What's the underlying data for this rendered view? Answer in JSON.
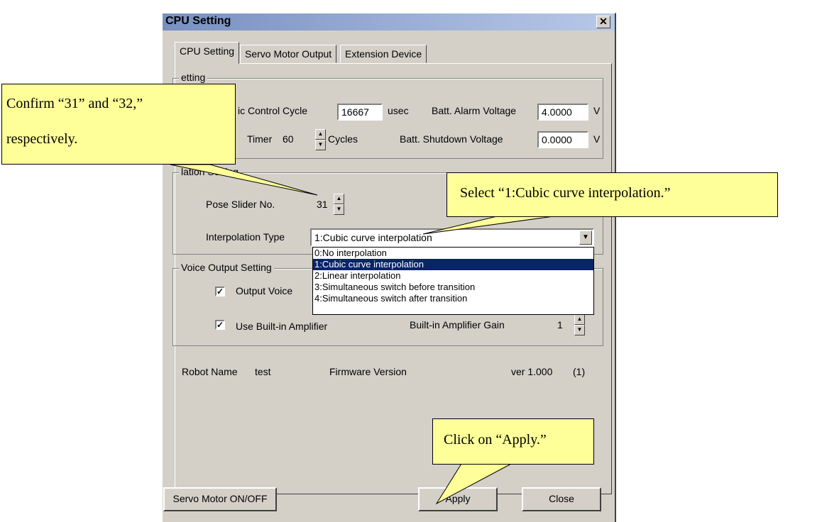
{
  "window": {
    "title": "CPU Setting",
    "close_glyph": "✕"
  },
  "tabs": [
    "CPU Setting",
    "Servo Motor Output",
    "Extension Device"
  ],
  "cpu_group": {
    "legend": "etting",
    "control_cycle_label": "ic Control Cycle",
    "control_cycle_value": "16667",
    "control_cycle_unit": "usec",
    "alarm_label": "Batt. Alarm Voltage",
    "alarm_value": "4.0000",
    "alarm_unit": "V",
    "timer_label": "Timer",
    "timer_value": "60",
    "timer_unit": "Cycles",
    "shutdown_label": "Batt. Shutdown Voltage",
    "shutdown_value": "0.0000",
    "shutdown_unit": "V"
  },
  "interp_group": {
    "legend": "lation Setting",
    "pose_label": "Pose Slider No.",
    "pose_value": "31",
    "type_label": "Interpolation Type",
    "type_value": "1:Cubic curve interpolation",
    "options": [
      "0:No interpolation",
      "1:Cubic curve interpolation",
      "2:Linear interpolation",
      "3:Simultaneous switch before transition",
      "4:Simultaneous switch after transition"
    ]
  },
  "voice_group": {
    "legend": "Voice Output Setting",
    "output_voice_label": "Output Voice",
    "output_voice_checked": true,
    "amp_label": "Use Built-in Amplifier",
    "amp_checked": true,
    "gain_label": "Built-in Amplifier Gain",
    "gain_value": "1"
  },
  "info": {
    "robot_name_label": "Robot Name",
    "robot_name": "test",
    "firmware_label": "Firmware Version",
    "firmware_version": "ver 1.000",
    "firmware_extra": "(1)"
  },
  "buttons": {
    "servo": "Servo Motor ON/OFF",
    "apply": "Apply",
    "close": "Close"
  },
  "callouts": {
    "confirm_line1": "Confirm “31” and “32,”",
    "confirm_line2": "respectively.",
    "select": "Select “1:Cubic curve interpolation.”",
    "apply": "Click on “Apply.”"
  },
  "colors": {
    "callout_bg": "#ffff99",
    "selection": "#0a246a",
    "dialog": "#d4d0c8"
  }
}
